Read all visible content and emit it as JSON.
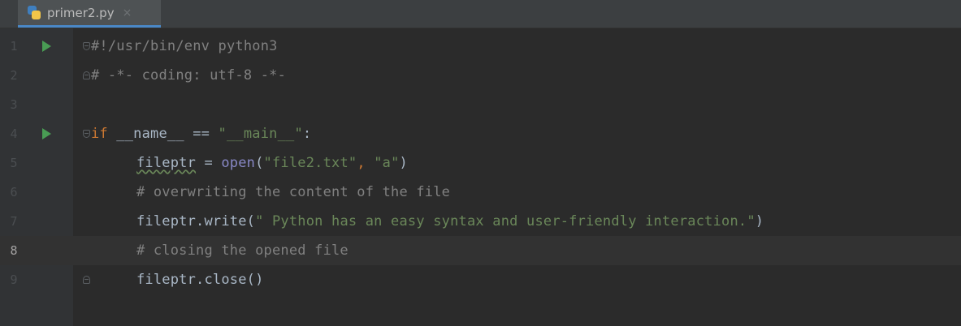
{
  "tab": {
    "file_name": "primer2.py",
    "close_glyph": "×",
    "icon": "python-file-icon"
  },
  "colors": {
    "background": "#2b2b2b",
    "keyword": "#cc7832",
    "comment": "#808080",
    "string": "#6a8759",
    "builtin": "#8888c6",
    "text": "#a9b7c6",
    "run_marker": "#499c54",
    "tab_underline": "#4a88c7"
  },
  "editor": {
    "current_line": 8,
    "lines": [
      {
        "num": "1",
        "text": "#!/usr/bin/env python3"
      },
      {
        "num": "2",
        "text": "# -*- coding: utf-8 -*-"
      },
      {
        "num": "3",
        "text": ""
      },
      {
        "num": "4",
        "kw": "if",
        "rest": " __name__ == ",
        "str": "\"__main__\"",
        "end": ":"
      },
      {
        "num": "5",
        "var": "fileptr",
        "mid": " = ",
        "func": "open",
        "open": "(",
        "s1": "\"file2.txt\"",
        "comma": ", ",
        "s2": "\"a\"",
        "close": ")"
      },
      {
        "num": "6",
        "text": "# overwriting the content of the file"
      },
      {
        "num": "7",
        "pre": "fileptr.write(",
        "str": "\" Python has an easy syntax and user-friendly interaction.\"",
        "close": ")"
      },
      {
        "num": "8",
        "text": "# closing the opened file"
      },
      {
        "num": "9",
        "text": "fileptr.close()"
      }
    ]
  }
}
